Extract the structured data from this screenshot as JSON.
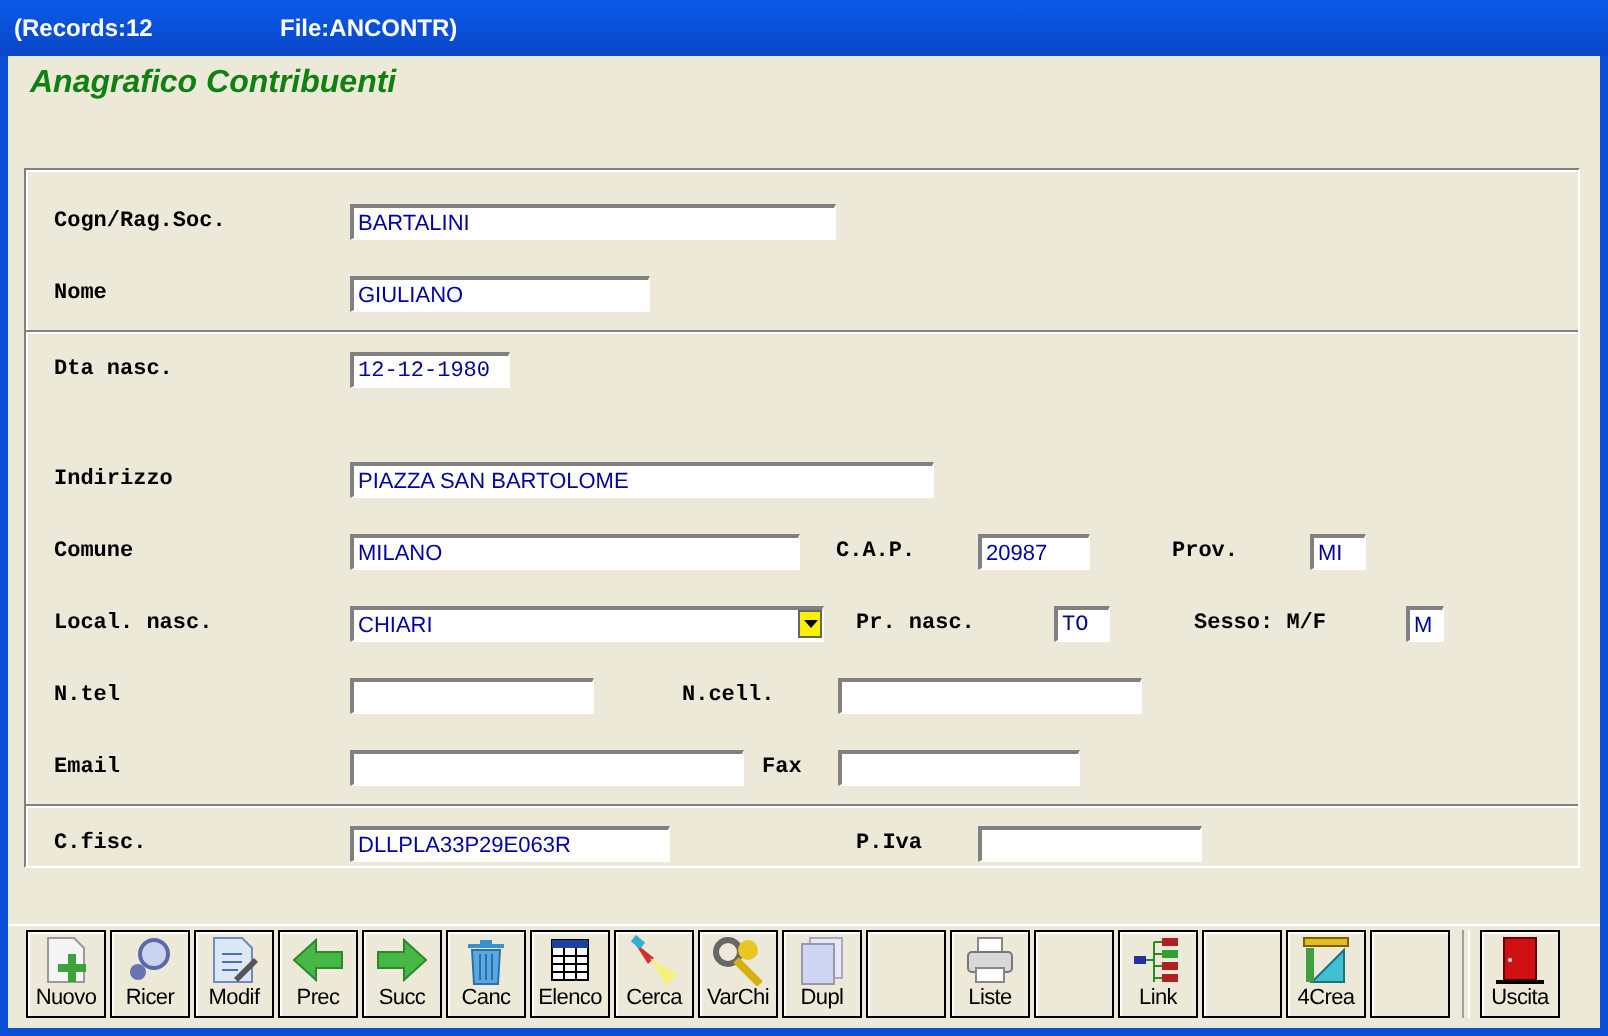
{
  "window": {
    "title_records": "(Records:12",
    "title_file": "File:ANCONTR)"
  },
  "heading": "Anagrafico Contribuenti",
  "rows": [
    {
      "kind": "row",
      "items": [
        {
          "label": "Cogn/Rag.Soc.",
          "value": "BARTALINI",
          "kind": "text"
        }
      ]
    },
    {
      "kind": "row",
      "items": [
        {
          "label": "Nome",
          "value": "GIULIANO",
          "kind": "text"
        }
      ]
    },
    {
      "kind": "separator"
    },
    {
      "kind": "row",
      "items": [
        {
          "label": "Dta nasc.",
          "value": "12-12-1980",
          "kind": "date"
        }
      ]
    },
    {
      "kind": "spacer"
    },
    {
      "kind": "row",
      "items": [
        {
          "label": "Indirizzo",
          "value": "PIAZZA SAN BARTOLOME",
          "kind": "text"
        }
      ]
    },
    {
      "kind": "row",
      "items": [
        {
          "label": "Comune",
          "value": "MILANO",
          "kind": "text"
        },
        {
          "label": "C.A.P.",
          "value": "20987",
          "kind": "text"
        },
        {
          "label": "Prov.",
          "value": "MI",
          "kind": "text"
        }
      ]
    },
    {
      "kind": "row",
      "items": [
        {
          "label": "Local. nasc.",
          "value": "CHIARI",
          "kind": "combo"
        },
        {
          "label": "Pr. nasc.",
          "value": "TO",
          "kind": "date"
        },
        {
          "label": "Sesso: M/F",
          "value": "M",
          "kind": "text"
        }
      ]
    },
    {
      "kind": "row",
      "items": [
        {
          "label": "N.tel",
          "kind": "text"
        },
        {
          "label": "N.cell.",
          "kind": "text"
        }
      ]
    },
    {
      "kind": "row",
      "items": [
        {
          "label": "Email",
          "kind": "text"
        },
        {
          "label": "Fax",
          "kind": "text"
        }
      ]
    },
    {
      "kind": "separator"
    },
    {
      "kind": "row",
      "items": [
        {
          "label": "C.fisc.",
          "value": "DLLPLA33P29E063R",
          "kind": "text"
        },
        {
          "label": "P.Iva",
          "kind": "text"
        }
      ]
    }
  ],
  "toolbar": [
    {
      "kind": "button",
      "label": "Nuovo"
    },
    {
      "kind": "button",
      "label": "Ricer"
    },
    {
      "kind": "button",
      "label": "Modif"
    },
    {
      "kind": "button",
      "label": "Prec"
    },
    {
      "kind": "button",
      "label": "Succ"
    },
    {
      "kind": "button",
      "label": "Canc"
    },
    {
      "kind": "button",
      "label": "Elenco"
    },
    {
      "kind": "button",
      "label": "Cerca"
    },
    {
      "kind": "button",
      "label": "VarChi"
    },
    {
      "kind": "button",
      "label": "Dupl"
    },
    {
      "kind": "blank"
    },
    {
      "kind": "button",
      "label": "Liste"
    },
    {
      "kind": "blank"
    },
    {
      "kind": "button",
      "label": "Link"
    },
    {
      "kind": "blank"
    },
    {
      "kind": "button",
      "label": "4Crea"
    },
    {
      "kind": "blank"
    },
    {
      "kind": "button",
      "label": "Uscita"
    }
  ]
}
